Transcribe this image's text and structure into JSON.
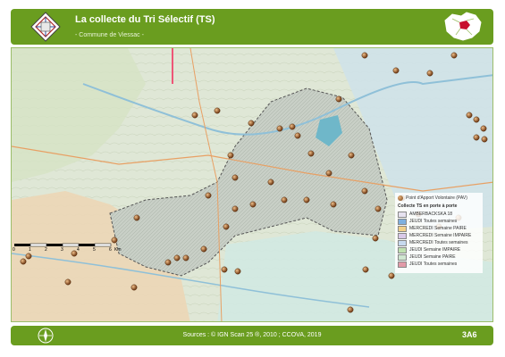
{
  "header": {
    "title": "La collecte du Tri Sélectif (TS)",
    "subtitle": "- Commune de Viessac -"
  },
  "legend": {
    "pav_label": "Point d'Apport Volontaire (PAV)",
    "collect_title": "Collecte TS en porte à porte",
    "items": [
      {
        "label": "AMBERBACKSKA 18",
        "color": "#e7e2f0"
      },
      {
        "label": "JEUDI Toutes semaines",
        "color": "#7fb0e0"
      },
      {
        "label": "MERCREDI Semaine PAIRE",
        "color": "#f2d08a"
      },
      {
        "label": "MERCREDI Semaine IMPAIRE",
        "color": "#d9c9e8"
      },
      {
        "label": "MERCREDI Toutes semaines",
        "color": "#c7d9ee"
      },
      {
        "label": "JEUDI Semaine IMPAIRE",
        "color": "#bfe1b0"
      },
      {
        "label": "JEUDI Semaine PAIRE",
        "color": "#cfe6d0"
      },
      {
        "label": "JEUDI Toutes semaines",
        "color": "#e29aa8"
      }
    ]
  },
  "scale": {
    "ticks": [
      "0",
      "1",
      "2",
      "3",
      "4",
      "5",
      "6"
    ],
    "unit": "Km"
  },
  "footer": {
    "sources": "Sources : © IGN Scan 25 ®, 2010 ; CCOVA, 2019",
    "brand": "3A6"
  },
  "colors": {
    "accent": "#6a9d1f",
    "pav": "#8b4a1e",
    "commune_fill": "#c8cfc6"
  }
}
